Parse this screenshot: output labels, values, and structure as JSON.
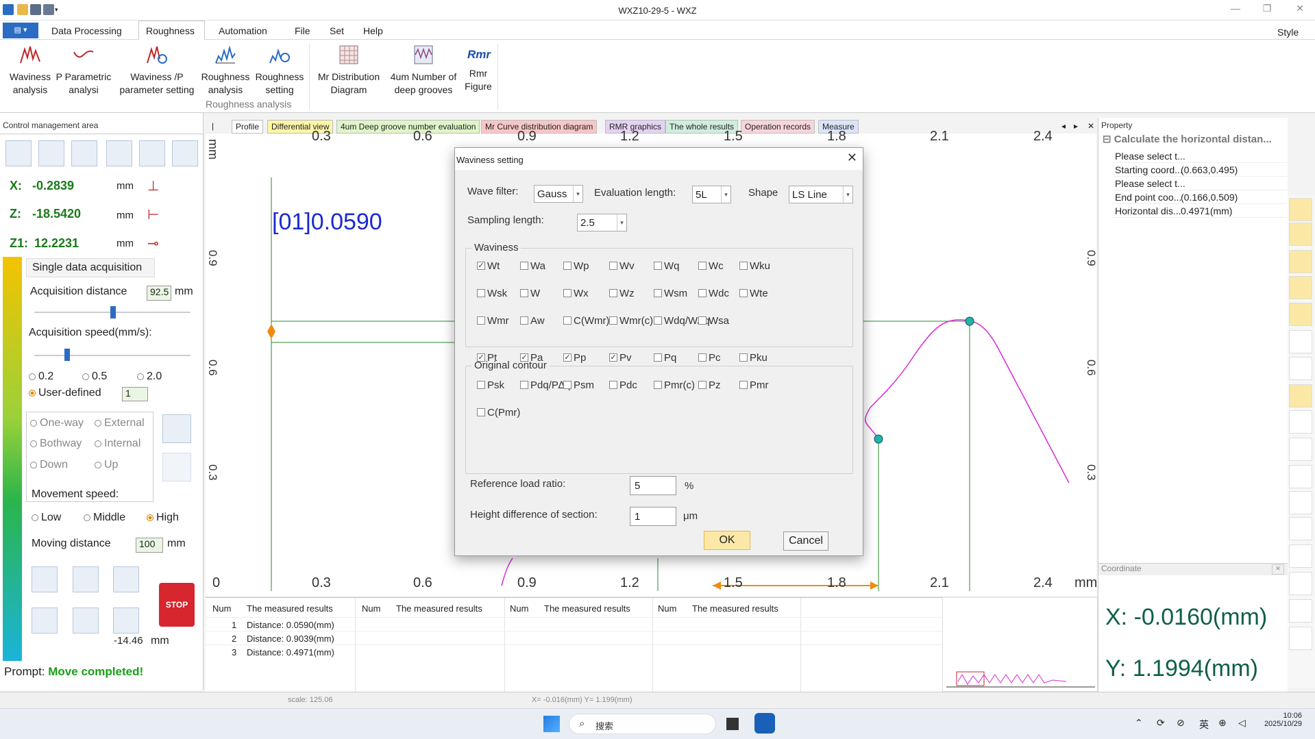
{
  "window": {
    "title": "WXZ10-29-5 - WXZ"
  },
  "menu": {
    "items": [
      "Data Processing",
      "Roughness",
      "Automation",
      "File",
      "Set",
      "Help"
    ],
    "style": "Style"
  },
  "ribbon": {
    "buttons": [
      {
        "line1": "Waviness",
        "line2": "analysis"
      },
      {
        "line1": "P Parametric",
        "line2": "analysi"
      },
      {
        "line1": "Waviness /P",
        "line2": "parameter setting"
      },
      {
        "line1": "Roughness",
        "line2": "analysis"
      },
      {
        "line1": "Roughness",
        "line2": "setting"
      },
      {
        "line1": "Mr Distribution",
        "line2": "Diagram"
      },
      {
        "line1": "4um Number of",
        "line2": "deep grooves"
      },
      {
        "line1": "Rmr",
        "line2": "Figure"
      }
    ],
    "group_label": "Roughness analysis",
    "rmr_icon_text": "Rmr"
  },
  "left": {
    "header": "Control management area",
    "x_label": "X:",
    "x_value": "-0.2839",
    "z_label": "Z:",
    "z_value": "-18.5420",
    "z1_label": "Z1:",
    "z1_value": "12.2231",
    "unit_mm": "mm",
    "single_acq": "Single data acquisition",
    "acq_distance_label": "Acquisition distance",
    "acq_distance_value": "92.5",
    "acq_speed_label": "Acquisition speed(mm/s):",
    "speed_opts": [
      "0.2",
      "0.5",
      "2.0"
    ],
    "user_defined": "User-defined",
    "user_defined_value": "1",
    "mode_opts": [
      "One-way",
      "External",
      "Bothway",
      "Internal",
      "Down",
      "Up"
    ],
    "movement_speed": "Movement speed:",
    "speed_levels": [
      "Low",
      "Middle",
      "High"
    ],
    "moving_distance": "Moving distance",
    "moving_distance_value": "100",
    "stop": "STOP",
    "offset_value": "-14.46",
    "prompt_label": "Prompt:",
    "prompt_value": "Move completed!"
  },
  "tabs": [
    "Profile",
    "Differential view",
    "4um Deep groove number evaluation",
    "Mr Curve distribution diagram",
    "RMR graphics",
    "The whole results",
    "Operation records",
    "Measure"
  ],
  "plot": {
    "x_ticks": [
      "0.3",
      "0.6",
      "0.9",
      "1.2",
      "1.5",
      "1.8",
      "2.1",
      "2.4"
    ],
    "bottom_ticks": [
      "0",
      "0.3",
      "0.6",
      "0.9",
      "1.2",
      "1.5",
      "1.8",
      "2.1",
      "2.4"
    ],
    "y_ticks": [
      "0.9",
      "0.6",
      "0.3"
    ],
    "unit_top": "mm",
    "unit_bottom": "mm",
    "annotation": "[01]0.0590"
  },
  "dialog": {
    "title": "Waviness setting",
    "wave_filter_label": "Wave filter:",
    "wave_filter_value": "Gauss",
    "eval_length_label": "Evaluation length:",
    "eval_length_value": "5L",
    "shape_label": "Shape",
    "shape_value": "LS Line",
    "sampling_label": "Sampling length:",
    "sampling_value": "2.5",
    "waviness_legend": "Waviness",
    "waviness_items": [
      {
        "label": "Wt",
        "checked": true
      },
      {
        "label": "Wa",
        "checked": false
      },
      {
        "label": "Wp",
        "checked": false
      },
      {
        "label": "Wv",
        "checked": false
      },
      {
        "label": "Wq",
        "checked": false
      },
      {
        "label": "Wc",
        "checked": false
      },
      {
        "label": "Wku",
        "checked": false
      },
      {
        "label": "Wsk",
        "checked": false
      },
      {
        "label": "W",
        "checked": false
      },
      {
        "label": "Wx",
        "checked": false
      },
      {
        "label": "Wz",
        "checked": false
      },
      {
        "label": "Wsm",
        "checked": false
      },
      {
        "label": "Wdc",
        "checked": false
      },
      {
        "label": "Wte",
        "checked": false
      },
      {
        "label": "Wmr",
        "checked": false
      },
      {
        "label": "Aw",
        "checked": false
      },
      {
        "label": "C(Wmr)",
        "checked": false
      },
      {
        "label": "Wmr(c)",
        "checked": false
      },
      {
        "label": "Wdq/W∆q",
        "checked": false
      },
      {
        "label": "Wsa",
        "checked": false
      }
    ],
    "contour_legend": "Original contour",
    "contour_items": [
      {
        "label": "Pt",
        "checked": true
      },
      {
        "label": "Pa",
        "checked": true
      },
      {
        "label": "Pp",
        "checked": true
      },
      {
        "label": "Pv",
        "checked": true
      },
      {
        "label": "Pq",
        "checked": false
      },
      {
        "label": "Pc",
        "checked": false
      },
      {
        "label": "Pku",
        "checked": false
      },
      {
        "label": "Psk",
        "checked": false
      },
      {
        "label": "Pdq/P∆q",
        "checked": false
      },
      {
        "label": "Psm",
        "checked": false
      },
      {
        "label": "Pdc",
        "checked": false
      },
      {
        "label": "Pmr(c)",
        "checked": false
      },
      {
        "label": "Pz",
        "checked": false
      },
      {
        "label": "Pmr",
        "checked": false
      },
      {
        "label": "C(Pmr)",
        "checked": false
      }
    ],
    "ref_load_label": "Reference load ratio:",
    "ref_load_value": "5",
    "ref_load_unit": "%",
    "height_diff_label": "Height difference of section:",
    "height_diff_value": "1",
    "height_diff_unit": "μm",
    "ok": "OK",
    "cancel": "Cancel"
  },
  "results": {
    "col_num": "Num",
    "col_res": "The measured results",
    "rows": [
      {
        "num": "1",
        "res": "Distance: 0.0590(mm)"
      },
      {
        "num": "2",
        "res": "Distance: 0.9039(mm)"
      },
      {
        "num": "3",
        "res": "Distance: 0.4971(mm)"
      }
    ]
  },
  "property": {
    "header": "Property",
    "group_title": "Calculate the horizontal distan...",
    "rows": [
      {
        "k": "Please select t...",
        "v": ""
      },
      {
        "k": "Starting coord...",
        "v": "(0.663,0.495)"
      },
      {
        "k": "Please select t...",
        "v": ""
      },
      {
        "k": "End point coo...",
        "v": "(0.166,0.509)"
      },
      {
        "k": "Horizontal dis...",
        "v": "0.4971(mm)"
      }
    ]
  },
  "coordinate": {
    "header": "Coordinate",
    "x_text": "X: -0.0160(mm)",
    "y_text": "Y:  1.1994(mm)"
  },
  "status": {
    "scale": "scale: 125.06",
    "xy": "X= -0.016(mm)  Y= 1.199(mm)"
  },
  "taskbar": {
    "search": "搜索",
    "ime": "英",
    "time": "10:06",
    "date": "2025/10/29"
  }
}
